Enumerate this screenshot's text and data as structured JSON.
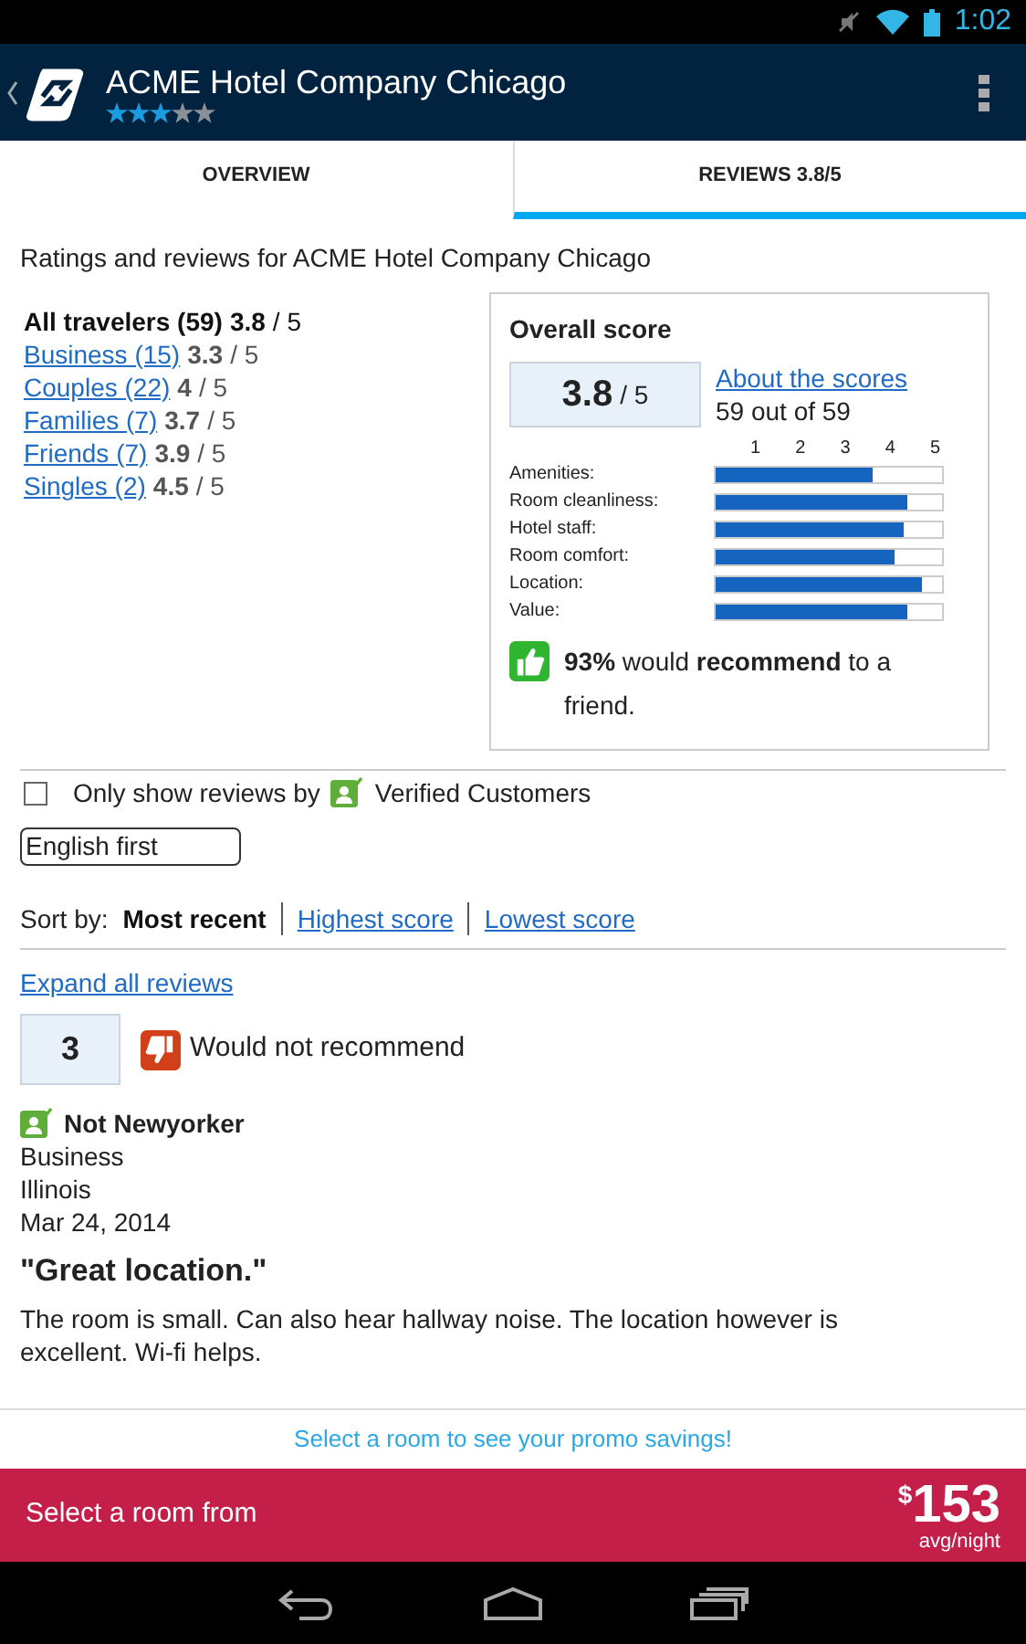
{
  "status_bar": {
    "time": "1:02"
  },
  "app_bar": {
    "title": "ACME Hotel Company Chicago",
    "stars": 3
  },
  "tabs": [
    {
      "label": "OVERVIEW",
      "selected": false
    },
    {
      "label": "REVIEWS 3.8/5",
      "selected": true
    }
  ],
  "heading": "Ratings and reviews for ACME Hotel Company Chicago",
  "traveler_scores": [
    {
      "kind": "total",
      "label": "All travelers (59)",
      "score": "3.8",
      "suffix": "/ 5"
    },
    {
      "kind": "link",
      "label": "Business (15)",
      "score": "3.3",
      "suffix": "/ 5"
    },
    {
      "kind": "link",
      "label": "Couples (22)",
      "score": "4",
      "suffix": "/ 5"
    },
    {
      "kind": "link",
      "label": "Families (7)",
      "score": "3.7",
      "suffix": "/ 5"
    },
    {
      "kind": "link",
      "label": "Friends (7)",
      "score": "3.9",
      "suffix": "/ 5"
    },
    {
      "kind": "link",
      "label": "Singles (2)",
      "score": "4.5",
      "suffix": "/ 5"
    }
  ],
  "overall": {
    "title": "Overall score",
    "score": "3.8",
    "suffix": "/ 5",
    "about_link": "About the scores",
    "count": "59 out of 59",
    "ticks": [
      "1",
      "2",
      "3",
      "4",
      "5"
    ],
    "categories": [
      {
        "label": "Amenities:",
        "level": 0.69
      },
      {
        "label": "Room cleanliness:",
        "level": 0.85
      },
      {
        "label": "Hotel staff:",
        "level": 0.83
      },
      {
        "label": "Room comfort:",
        "level": 0.79
      },
      {
        "label": "Location:",
        "level": 0.91
      },
      {
        "label": "Value:",
        "level": 0.85
      }
    ],
    "recommend": "**93%** would **recommend** to a friend."
  },
  "filter": {
    "label": "Only show reviews by",
    "badge_label": "Verified Customers",
    "checked": false
  },
  "language": {
    "value": "English first"
  },
  "sort": {
    "label": "Sort by:",
    "options": [
      {
        "label": "Most recent",
        "selected": true
      },
      {
        "label": "Highest score",
        "selected": false
      },
      {
        "label": "Lowest score",
        "selected": false
      }
    ]
  },
  "expand_link": "Expand all reviews",
  "reviews": [
    {
      "score": "3",
      "recommend": false,
      "recommend_text": "Would not recommend",
      "author": "Not Newyorker",
      "trip_type": "Business",
      "location": "Illinois",
      "date": "Mar 24, 2014",
      "title": "\"Great location.\"",
      "body": "The room is small. Can also hear hallway noise. The location however is excellent. Wi-fi helps."
    }
  ],
  "promo": "Select a room to see your promo savings!",
  "booking_bar": {
    "label": "Select a room from",
    "currency": "$",
    "amount": "153",
    "unit": "avg/night"
  }
}
